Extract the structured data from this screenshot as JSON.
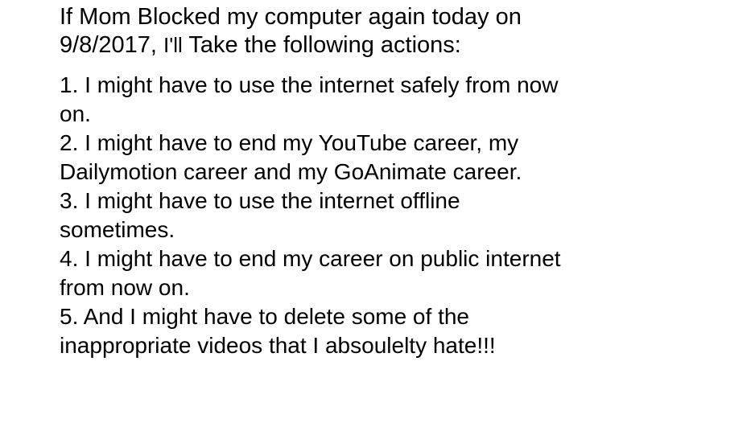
{
  "heading": {
    "line1": "If Mom Blocked my computer again today on",
    "line2_date": "9/8/2017,",
    "line2_ill": "I'll",
    "line2_rest": "Take the following actions:"
  },
  "items": [
    {
      "line1": "1. I might have to use the internet safely from now",
      "line2": "on."
    },
    {
      "line1": "2. I might have to end my YouTube career, my",
      "line2": "Dailymotion career and my GoAnimate career."
    },
    {
      "line1": "3. I might have to use the internet offline",
      "line2": "sometimes."
    },
    {
      "line1": "4. I might have to end my career on public internet",
      "line2": "from now on."
    },
    {
      "line1": "5. And I might have to delete some of the",
      "line2": "inappropriate videos that I absoulelty hate!!!"
    }
  ],
  "colors": {
    "background": "#ffffff",
    "text": "#000000"
  }
}
